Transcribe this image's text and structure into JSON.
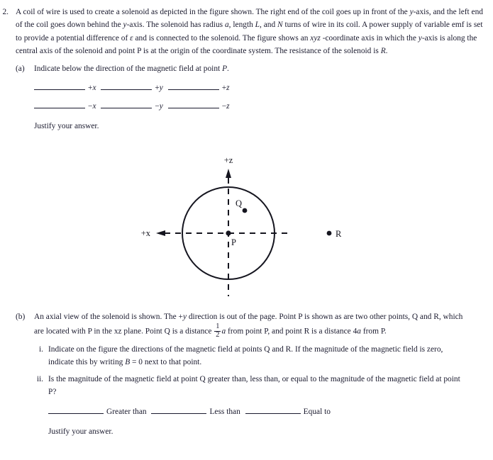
{
  "problem": {
    "number": "2.",
    "stem_segments": [
      {
        "t": "A coil of wire is used to create a solenoid as depicted in the figure shown. The right end of the coil goes up in front of the "
      },
      {
        "t": "y",
        "i": true
      },
      {
        "t": "-axis, and the left end of the coil goes down behind the "
      },
      {
        "t": "y",
        "i": true
      },
      {
        "t": "-axis. The solenoid has radius "
      },
      {
        "t": "a",
        "i": true
      },
      {
        "t": ", length "
      },
      {
        "t": "L",
        "i": true
      },
      {
        "t": ", and "
      },
      {
        "t": "N",
        "i": true
      },
      {
        "t": " turns of wire in its coil. A power supply of variable emf is set to provide a potential difference of "
      },
      {
        "t": "ε",
        "i": true
      },
      {
        "t": " and is connected to the solenoid. The figure shows an "
      },
      {
        "t": "xyz",
        "i": true
      },
      {
        "t": " -coordinate axis in which the "
      },
      {
        "t": "y",
        "i": true
      },
      {
        "t": "-axis is along the central axis of the solenoid and point P is at the origin of the coordinate system. The resistance of the solenoid is "
      },
      {
        "t": "R",
        "i": true
      },
      {
        "t": "."
      }
    ]
  },
  "part_a": {
    "label": "(a)",
    "prompt_before": "Indicate below the direction of the magnetic field at point ",
    "prompt_italic": "P",
    "prompt_after": ".",
    "row1": [
      {
        "sign": "+",
        "axis": "x"
      },
      {
        "sign": "+",
        "axis": "y"
      },
      {
        "sign": "+",
        "axis": "z"
      }
    ],
    "row2": [
      {
        "sign": "−",
        "axis": "x"
      },
      {
        "sign": "−",
        "axis": "y"
      },
      {
        "sign": "−",
        "axis": "z"
      }
    ],
    "justify": "Justify your answer."
  },
  "figure": {
    "axis_z_label": "+z",
    "axis_x_label": "+x",
    "point_p_label": "P",
    "point_q_label": "Q",
    "point_r_label": "R"
  },
  "part_b": {
    "label": "(b)",
    "text_segments": [
      {
        "t": "An axial view of the solenoid is shown. The +"
      },
      {
        "t": "y",
        "i": true
      },
      {
        "t": " direction is out of the page. Point P is shown as are two other points, Q and R, which are located with P in the xz plane. Point Q is a distance "
      },
      {
        "frac": {
          "num": "1",
          "den": "2"
        }
      },
      {
        "t": "a",
        "i": true
      },
      {
        "t": "  from point P, and point R is a distance 4"
      },
      {
        "t": "a",
        "i": true
      },
      {
        "t": " from P."
      }
    ],
    "subparts": [
      {
        "label": "i.",
        "segments": [
          {
            "t": "Indicate on the figure the directions of the magnetic field at points Q and R. If the magnitude of the magnetic field is zero, indicate this by writing "
          },
          {
            "t": "B",
            "i": true
          },
          {
            "t": " = 0 next to that point."
          }
        ]
      },
      {
        "label": "ii.",
        "segments": [
          {
            "t": "Is the magnitude of the magnetic field at point Q greater than, less than, or equal to the magnitude of the magnetic field at point P?"
          }
        ]
      }
    ],
    "choices": [
      "Greater than",
      "Less than",
      "Equal to"
    ],
    "justify": "Justify your answer."
  }
}
